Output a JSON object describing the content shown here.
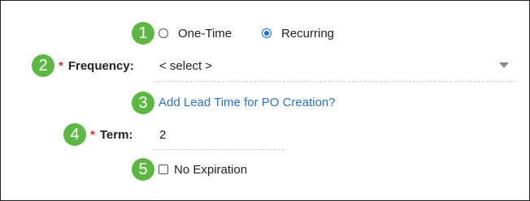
{
  "badges": [
    "1",
    "2",
    "3",
    "4",
    "5"
  ],
  "schedule": {
    "options": [
      {
        "label": "One-Time",
        "checked": false
      },
      {
        "label": "Recurring",
        "checked": true
      }
    ]
  },
  "frequency": {
    "required_mark": "*",
    "label": "Frequency:",
    "value": "< select >"
  },
  "lead_time": {
    "link": "Add Lead Time for PO Creation?"
  },
  "term": {
    "required_mark": "*",
    "label": "Term:",
    "value": "2"
  },
  "expiration": {
    "label": "No Expiration",
    "checked": false
  },
  "colors": {
    "badge": "#5cb843",
    "required": "#d9342b",
    "link": "#2a73c0",
    "radio_selected": "#0a6ee0"
  }
}
